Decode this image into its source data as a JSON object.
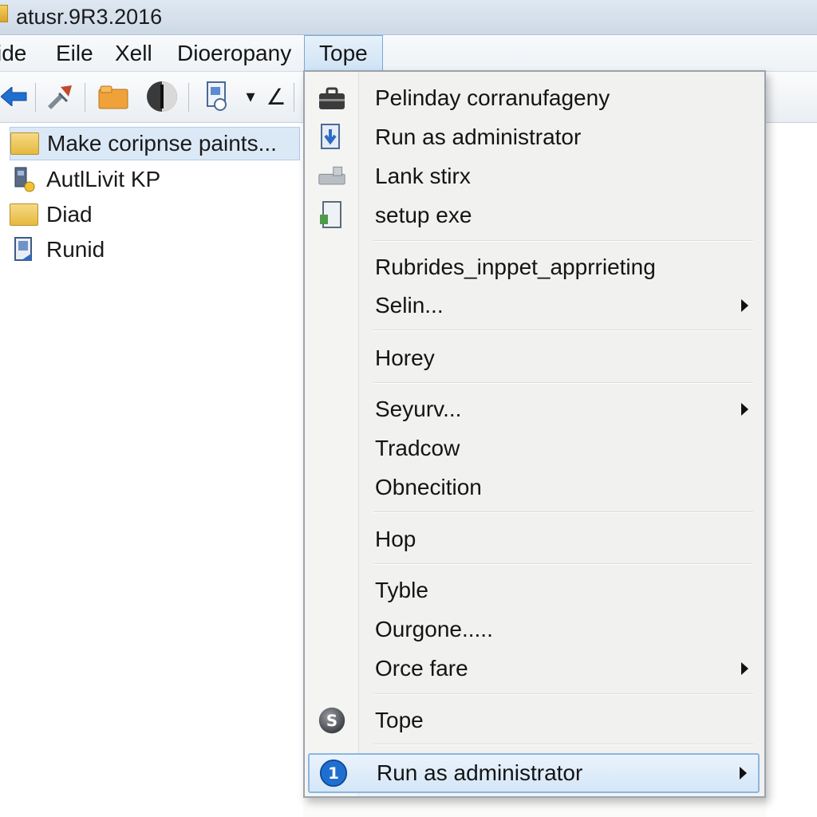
{
  "window": {
    "title": "atusr.9R3.2016"
  },
  "menubar": {
    "items": [
      "ide",
      "Eile",
      "Xell",
      "Dioeropany",
      "Tope"
    ]
  },
  "toolbar": {
    "dropdown_glyph": "▾",
    "extra_glyph": "∠"
  },
  "tree": {
    "items": [
      {
        "label": "Make coripnse paints...",
        "icon": "folder-icon",
        "selected": true
      },
      {
        "label": "AutlLivit KP",
        "icon": "computer-user-icon",
        "selected": false
      },
      {
        "label": "Diad",
        "icon": "folder-icon",
        "selected": false
      },
      {
        "label": "Runid",
        "icon": "shortcut-icon",
        "selected": false
      }
    ]
  },
  "context_menu": {
    "items": [
      {
        "label": "Pelinday corranufageny",
        "icon": "briefcase-icon",
        "submenu": false
      },
      {
        "label": "Run as administrator",
        "icon": "install-icon",
        "submenu": false
      },
      {
        "label": "Lank stirx",
        "icon": "printer-icon",
        "submenu": false
      },
      {
        "label": "setup exe",
        "icon": "setup-file-icon",
        "submenu": false
      },
      {
        "label": "Rubrides_inppet_apprrieting",
        "icon": "",
        "submenu": false
      },
      {
        "label": "Selin...",
        "icon": "",
        "submenu": true
      },
      {
        "label": "Horey",
        "icon": "",
        "submenu": false
      },
      {
        "label": "Seyurv...",
        "icon": "",
        "submenu": true
      },
      {
        "label": "Tradcow",
        "icon": "",
        "submenu": false
      },
      {
        "label": "Obnecition",
        "icon": "",
        "submenu": false
      },
      {
        "label": "Hop",
        "icon": "",
        "submenu": false
      },
      {
        "label": "Tyble",
        "icon": "",
        "submenu": false
      },
      {
        "label": "Ourgone.....",
        "icon": "",
        "submenu": false
      },
      {
        "label": "Orce fare",
        "icon": "",
        "submenu": true
      },
      {
        "label": "Tope",
        "icon": "s-badge-icon",
        "icon_text": "S",
        "submenu": false
      },
      {
        "label": "Run as administrator",
        "icon": "info-icon",
        "icon_text": "1",
        "submenu": true,
        "highlighted": true
      }
    ]
  }
}
